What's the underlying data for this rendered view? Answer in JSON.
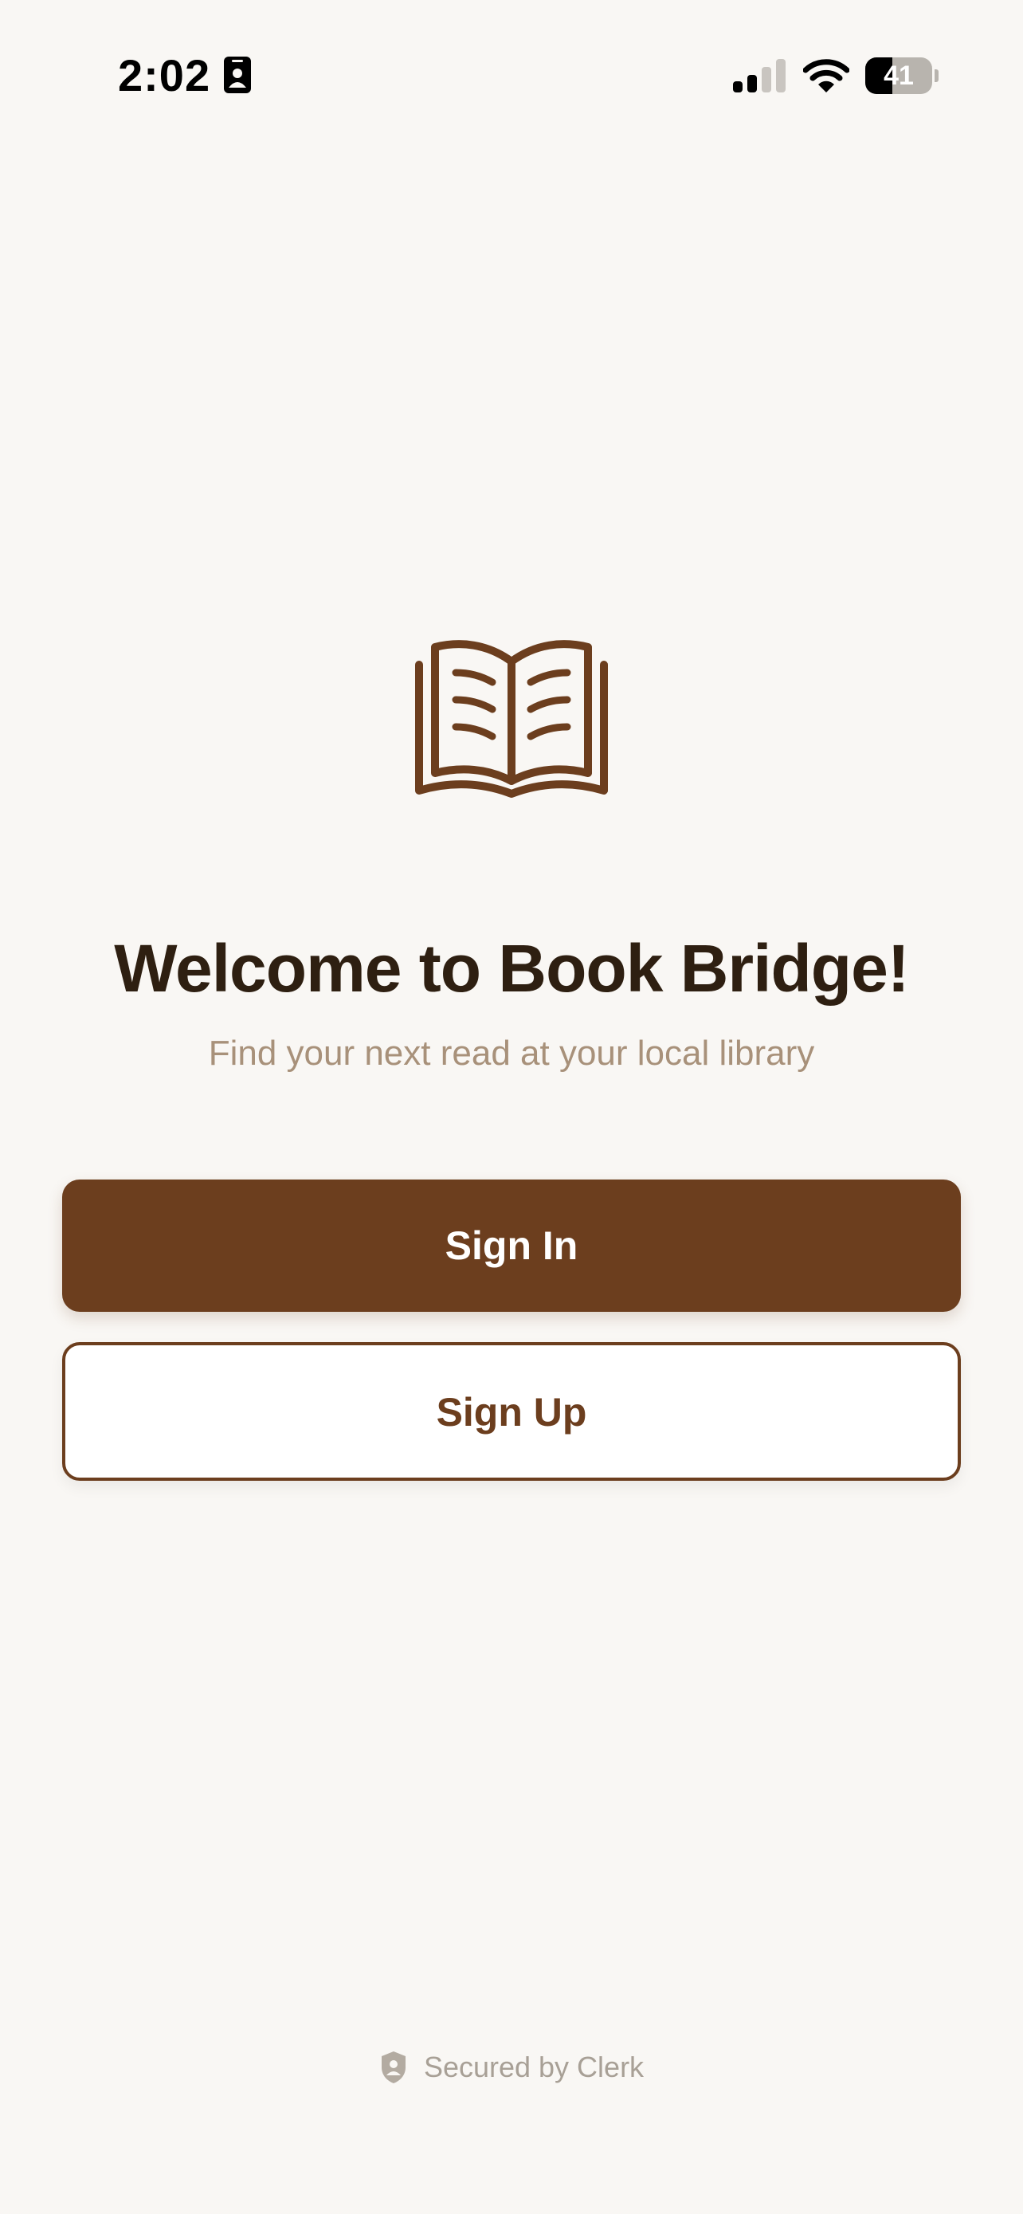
{
  "status_bar": {
    "time": "2:02",
    "battery_level": "41",
    "icons": [
      "contact-card-icon",
      "cellular-signal-icon",
      "wifi-icon",
      "battery-icon"
    ]
  },
  "welcome": {
    "logo_icon": "open-book-icon",
    "title": "Welcome to Book Bridge!",
    "subtitle": "Find your next read at your local library"
  },
  "actions": {
    "sign_in_label": "Sign In",
    "sign_up_label": "Sign Up"
  },
  "footer": {
    "icon": "shield-icon",
    "text": "Secured by Clerk"
  },
  "colors": {
    "background": "#f9f7f4",
    "brand_brown": "#6c3e1e",
    "title_text": "#2e1f11",
    "subtitle_text": "#a8917a",
    "footer_text": "#a8a096"
  }
}
